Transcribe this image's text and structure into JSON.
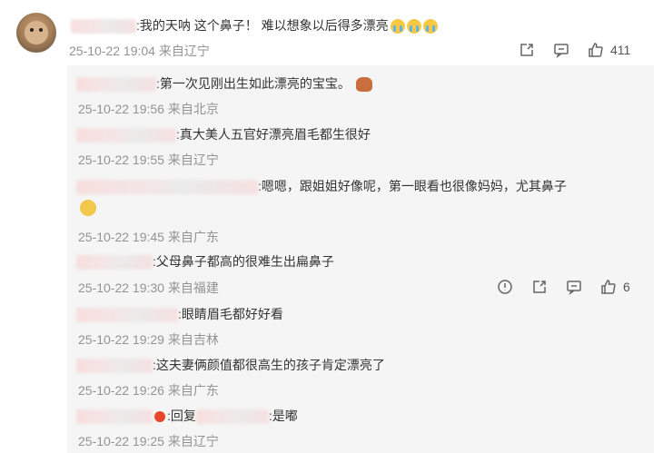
{
  "main_comment": {
    "text": ":我的天呐  这个鼻子！  难以想象以后得多漂亮",
    "timestamp": "25-10-22 19:04",
    "location": "来自辽宁",
    "like_count": "411",
    "emoji": "crying-emoji"
  },
  "replies": [
    {
      "text": ":第一次见刚出生如此漂亮的宝宝。",
      "timestamp": "25-10-22 19:56",
      "location": "来自北京"
    },
    {
      "text": ":真大美人五官好漂亮眉毛都生很好",
      "timestamp": "25-10-22 19:55",
      "location": "来自辽宁"
    },
    {
      "text": ":嗯嗯，跟姐姐好像呢，第一眼看也很像妈妈，尤其鼻子",
      "timestamp": "25-10-22 19:45",
      "location": "来自广东"
    },
    {
      "text": ":父母鼻子都高的很难生出扁鼻子",
      "timestamp": "25-10-22 19:30",
      "location": "来自福建",
      "like_count": "6"
    },
    {
      "text": ":眼睛眉毛都好好看",
      "timestamp": "25-10-22 19:29",
      "location": "来自吉林"
    },
    {
      "text": ":这夫妻俩颜值都很高生的孩子肯定漂亮了",
      "timestamp": "25-10-22 19:26",
      "location": "来自广东"
    },
    {
      "text_prefix": ":回复",
      "text": ":是嘟",
      "timestamp": "25-10-22 19:25",
      "location": "来自辽宁"
    }
  ],
  "colors": {
    "meta_gray": "#939393",
    "reply_bg": "#f5f5f5",
    "badge_red": "#e8452c"
  }
}
